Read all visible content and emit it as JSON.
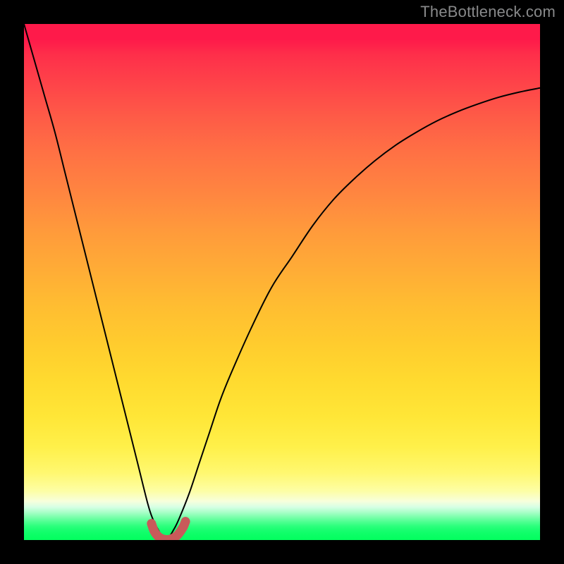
{
  "watermark": "TheBottleneck.com",
  "colors": {
    "page_bg": "#000000",
    "curve_stroke": "#000000",
    "marker_stroke": "#c85a5a",
    "gradient_top": "#fe1a4a",
    "gradient_bottom": "#03fe5f"
  },
  "chart_data": {
    "type": "line",
    "title": "",
    "xlabel": "",
    "ylabel": "",
    "xlim": [
      0,
      100
    ],
    "ylim": [
      0,
      100
    ],
    "grid": false,
    "legend": false,
    "notes": "Background is a vertical red→orange→yellow→green gradient filling the plot area. A single black curve descends steeply from upper-left, reaches ~0 near x≈27, then rises with diminishing slope toward the upper-right. A short thick reddish U-shaped marker highlights the minimum region near x≈25–31 at y≈0–2.",
    "series": [
      {
        "name": "bottleneck-curve",
        "color": "#000000",
        "x": [
          0,
          2,
          4,
          6,
          8,
          10,
          12,
          14,
          16,
          18,
          20,
          22,
          24,
          25,
          26,
          27,
          28,
          29,
          30,
          32,
          34,
          36,
          38,
          40,
          44,
          48,
          52,
          56,
          60,
          64,
          68,
          72,
          76,
          80,
          84,
          88,
          92,
          96,
          100
        ],
        "y": [
          100,
          93,
          86,
          79,
          71,
          63,
          55,
          47,
          39,
          31,
          23,
          15,
          7,
          4,
          2,
          0.5,
          0.5,
          2,
          4,
          9,
          15,
          21,
          27,
          32,
          41,
          49,
          55,
          61,
          66,
          70,
          73.5,
          76.5,
          79,
          81.2,
          83,
          84.5,
          85.8,
          86.8,
          87.6
        ]
      },
      {
        "name": "minimum-marker",
        "color": "#c85a5a",
        "x": [
          24.7,
          25.2,
          25.8,
          26.5,
          27.3,
          28.1,
          28.9,
          29.7,
          30.4,
          30.9,
          31.3
        ],
        "y": [
          3.2,
          1.8,
          0.9,
          0.35,
          0.1,
          0.1,
          0.35,
          0.9,
          1.8,
          2.6,
          3.6
        ]
      }
    ]
  }
}
